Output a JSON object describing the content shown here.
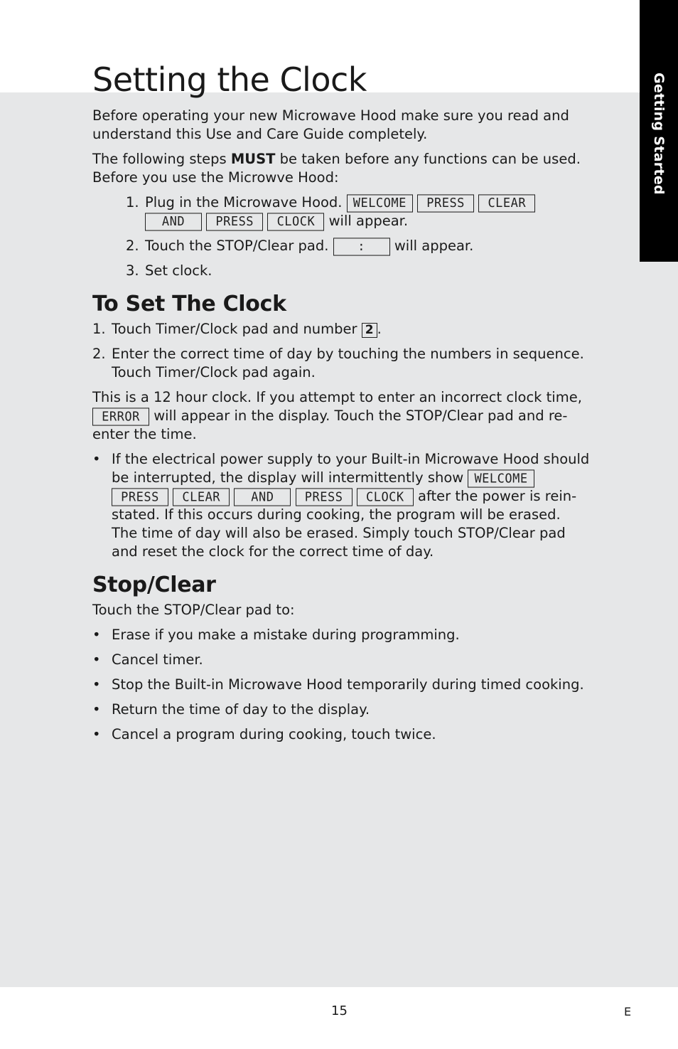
{
  "side_tab": {
    "label": "Getting Started"
  },
  "title": "Setting the Clock",
  "intro": {
    "p1": "Before operating your new Microwave Hood make sure you read and understand this Use and Care Guide completely.",
    "p2_pre": "The following steps ",
    "p2_bold": "MUST",
    "p2_post": " be taken before any functions can be used. Before you use the Microwve Hood:",
    "steps": [
      {
        "num": "1.",
        "text": "Plug in the Microwave Hood.",
        "displays": [
          "WELCOME",
          "PRESS",
          "CLEAR",
          "AND",
          "PRESS",
          "CLOCK"
        ],
        "suffix": "will appear."
      },
      {
        "num": "2.",
        "text": "Touch the STOP/Clear pad.",
        "displays": [
          ":"
        ],
        "suffix": "will appear."
      },
      {
        "num": "3.",
        "text": "Set clock."
      }
    ]
  },
  "set_clock": {
    "heading": "To Set The Clock",
    "steps": [
      {
        "num": "1.",
        "text": "Touch Timer/Clock pad and number",
        "key": "2",
        "suffix": "."
      },
      {
        "num": "2.",
        "text": "Enter the correct time of day by touching the numbers in sequence. Touch Timer/Clock pad again."
      }
    ],
    "note_pre": "This is a 12 hour clock. If you attempt to enter an incorrect clock time,",
    "note_display": "ERROR",
    "note_post": "will appear in the display. Touch the STOP/Clear pad and re-enter the time.",
    "bullet": {
      "pre": "If the electrical power supply to your Built-in Microwave Hood should be interrupted, the display will intermittently show",
      "displays": [
        "WELCOME",
        "PRESS",
        "CLEAR",
        "AND",
        "PRESS",
        "CLOCK"
      ],
      "post": "after the power is rein-stated. If this occurs during cooking, the program will be erased. The time of day will also be erased. Simply touch STOP/Clear pad and reset the clock for the correct time of day."
    }
  },
  "stop_clear": {
    "heading": "Stop/Clear",
    "intro": "Touch the STOP/Clear pad to:",
    "items": [
      "Erase if you make a mistake during programming.",
      "Cancel timer.",
      "Stop the Built-in Microwave Hood temporarily during timed cooking.",
      "Return the time of day to the display.",
      "Cancel a program during cooking, touch twice."
    ]
  },
  "footer": {
    "page_number": "15",
    "language": "E"
  },
  "colors": {
    "band": "#e6e7e8",
    "tab": "#000000",
    "text": "#1a1a1a"
  }
}
